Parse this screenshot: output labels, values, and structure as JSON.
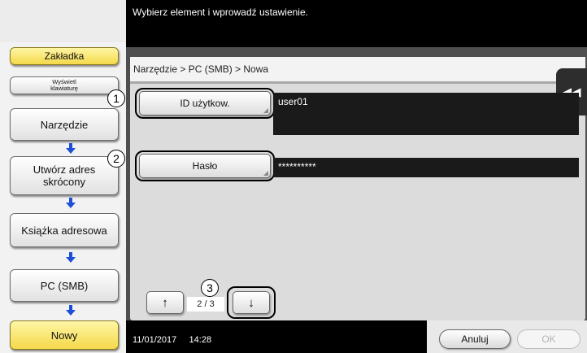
{
  "header": {
    "message": "Wybierz element i wprowadź ustawienie."
  },
  "sidebar": {
    "tab_label": "Zakładka",
    "keyboard_label_line1": "Wyświetl",
    "keyboard_label_line2": "klawiaturę",
    "steps": [
      {
        "label": "Narzędzie"
      },
      {
        "label": "Utwórz adres skrócony"
      },
      {
        "label": "Książka adresowa"
      },
      {
        "label": "PC (SMB)"
      },
      {
        "label": "Nowy"
      }
    ]
  },
  "breadcrumb": "Narzędzie > PC (SMB) > Nowa",
  "fields": {
    "user_id": {
      "label": "ID użytkow.",
      "value": "user01"
    },
    "password": {
      "label": "Hasło",
      "value": "**********"
    }
  },
  "callouts": [
    "1",
    "2",
    "3"
  ],
  "pager": {
    "current": "2",
    "separator": "/",
    "total": "3",
    "up_symbol": "↑",
    "down_symbol": "↓"
  },
  "side_tab_symbol": "◀◀",
  "footer": {
    "date": "11/01/2017",
    "time": "14:28",
    "cancel_label": "Anuluj",
    "ok_label": "OK"
  },
  "colors": {
    "accent_yellow": "#f4d94a",
    "top_bar": "#000000",
    "field_value_bg": "#1a1a1a",
    "arrow_blue": "#1f4fd8"
  }
}
